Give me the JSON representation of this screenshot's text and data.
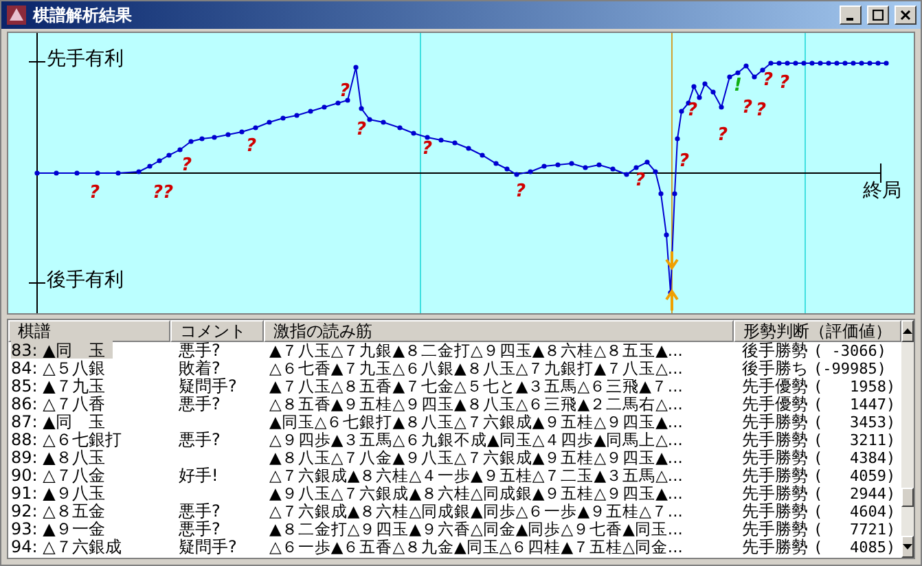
{
  "window": {
    "title": "棋譜解析結果"
  },
  "graph": {
    "top_label": "先手有利",
    "bottom_label": "後手有利",
    "end_label": "終局",
    "marks": [
      {
        "text": "?",
        "kind": "bad"
      },
      {
        "text": "??",
        "kind": "bad"
      },
      {
        "text": "?",
        "kind": "bad"
      },
      {
        "text": "?",
        "kind": "bad"
      },
      {
        "text": "?",
        "kind": "bad"
      },
      {
        "text": "?",
        "kind": "bad"
      },
      {
        "text": "?",
        "kind": "bad"
      },
      {
        "text": "?",
        "kind": "bad"
      },
      {
        "text": "?",
        "kind": "bad"
      },
      {
        "text": "?",
        "kind": "bad"
      },
      {
        "text": "?",
        "kind": "bad"
      },
      {
        "text": "?",
        "kind": "bad"
      },
      {
        "text": "!",
        "kind": "good"
      },
      {
        "text": "?",
        "kind": "bad"
      },
      {
        "text": "?",
        "kind": "bad"
      },
      {
        "text": "?",
        "kind": "bad"
      },
      {
        "text": "?",
        "kind": "bad"
      }
    ]
  },
  "table": {
    "columns": [
      "棋譜",
      "コメント",
      "激指の読み筋",
      "形勢判断（評価値）"
    ],
    "rows": [
      {
        "move": "83: ▲同　玉",
        "comment": "悪手?",
        "line": "▲７八玉△７九銀▲８二金打△９四玉▲８六桂△８五玉▲...",
        "judgment": "後手勝勢",
        "value": "( -3066)",
        "selected": true
      },
      {
        "move": "84: △５八銀",
        "comment": "敗着?",
        "line": "△６七香▲７九玉△６八銀▲８八玉△７九銀打▲７八玉△...",
        "judgment": "後手勝ち",
        "value": "(-99985)",
        "selected": false
      },
      {
        "move": "85: ▲７九玉",
        "comment": "疑問手?",
        "line": "▲７八玉△８五香▲７七金△５七と▲３五馬△６三飛▲７...",
        "judgment": "先手優勢",
        "value": "(   1958)",
        "selected": false
      },
      {
        "move": "86: △７八香",
        "comment": "悪手?",
        "line": "△８五香▲９五桂△９四玉▲８八玉△６三飛▲２二馬右△...",
        "judgment": "先手優勢",
        "value": "(   1447)",
        "selected": false
      },
      {
        "move": "87: ▲同　玉",
        "comment": "",
        "line": "▲同玉△６七銀打▲８八玉△７六銀成▲９五桂△９四玉▲...",
        "judgment": "先手勝勢",
        "value": "(   3453)",
        "selected": false
      },
      {
        "move": "88: △６七銀打",
        "comment": "悪手?",
        "line": "△９四歩▲３五馬△６九銀不成▲同玉△４四歩▲同馬上△...",
        "judgment": "先手勝勢",
        "value": "(   3211)",
        "selected": false
      },
      {
        "move": "89: ▲８八玉",
        "comment": "",
        "line": "▲８八玉△７八金▲９八玉△７六銀成▲９五桂△９四玉▲...",
        "judgment": "先手勝勢",
        "value": "(   4384)",
        "selected": false
      },
      {
        "move": "90: △７八金",
        "comment": "好手!",
        "line": "△７六銀成▲８六桂△４一歩▲９五桂△７二玉▲３五馬△...",
        "judgment": "先手勝勢",
        "value": "(   4059)",
        "selected": false
      },
      {
        "move": "91: ▲９八玉",
        "comment": "",
        "line": "▲９八玉△７六銀成▲８六桂△同成銀▲９五桂△９四玉▲...",
        "judgment": "先手勝勢",
        "value": "(   2944)",
        "selected": false
      },
      {
        "move": "92: △８五金",
        "comment": "悪手?",
        "line": "△７六銀成▲８六桂△同成銀▲同歩△６一歩▲９五桂△７...",
        "judgment": "先手勝勢",
        "value": "(   4604)",
        "selected": false
      },
      {
        "move": "93: ▲９一金",
        "comment": "悪手?",
        "line": "▲８二金打△９四玉▲９六香△同金▲同歩△９七香▲同玉...",
        "judgment": "先手勝勢",
        "value": "(   7721)",
        "selected": false
      },
      {
        "move": "94: △７六銀成",
        "comment": "疑問手?",
        "line": "△６一歩▲６五香△８九金▲同玉△６四桂▲７五桂△同金...",
        "judgment": "先手勝勢",
        "value": "(   4085)",
        "selected": false
      }
    ]
  }
}
